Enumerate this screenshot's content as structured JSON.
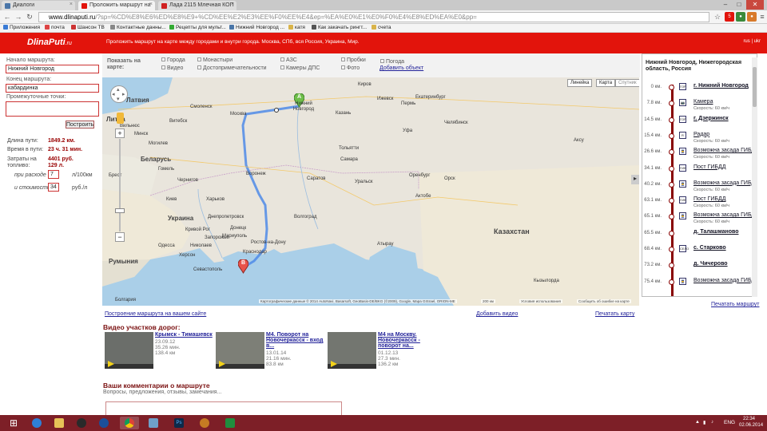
{
  "browser": {
    "tabs": [
      {
        "label": "Диалоги",
        "color": "#4a76a8"
      },
      {
        "label": "Проложить маршрут на",
        "color": "#e2140c",
        "active": true
      },
      {
        "label": "Лада 2115 Млечная КОП",
        "color": "#d02020"
      }
    ],
    "url_host": "www.dlinaputi.ru",
    "url_rest": "/?sp=%CD%E8%E6%ED%E8%E9+%CD%EE%E2%E3%EE%F0%EE%E4&ep=%EA%E0%E1%E0%F0%E4%E8%ED%EA%E0&pp=",
    "bookmarks": [
      {
        "label": "Приложения",
        "color": "#3a7bd5"
      },
      {
        "label": "почта",
        "color": "#d44"
      },
      {
        "label": "Шансон ТВ",
        "color": "#c33"
      },
      {
        "label": "Контактные данны...",
        "color": "#888"
      },
      {
        "label": "Рецепты для мульт...",
        "color": "#3a3"
      },
      {
        "label": "Нижний Новгород ...",
        "color": "#4a76a8"
      },
      {
        "label": "катя",
        "color": "#d9b44a"
      },
      {
        "label": "Как закачать рингт...",
        "color": "#555"
      },
      {
        "label": "счета",
        "color": "#d9b44a"
      }
    ]
  },
  "site": {
    "logo": "DlinaPuti",
    "logo_suffix": ".ru",
    "slogan": "Проложить маршрут на карте между городами и внутри города. Москва, СПб, вся Россия, Украина, Мир.",
    "header_right": "rus | ukr"
  },
  "form": {
    "start_label": "Начало маршрута:",
    "start_value": "Нижний Новгород",
    "end_label": "Конец маршрута:",
    "end_value": "кабардинка",
    "via_label": "Промежуточные точки:",
    "button": "Построить"
  },
  "stats": {
    "length_label": "Длина пути:",
    "length_value": "1849.2  км.",
    "time_label": "Время в пути:",
    "time_value": "23 ч. 31 мин.",
    "cost_label": "Затраты на топливо:",
    "cost_value": "4401   руб.",
    "fuel_value": "129     л.",
    "consumption_label": "при расходе",
    "consumption_value": "7",
    "consumption_unit": "л/100км",
    "price_label": "и стоимости",
    "price_value": "34",
    "price_unit": "руб./л"
  },
  "maptools": {
    "show_label": "Показать на карте:",
    "checks": [
      "Города",
      "Видео",
      "Монастыри",
      "Достопримечательности",
      "АЗС",
      "Камеры ДПС",
      "Пробки",
      "Фото",
      "Погода"
    ],
    "add_object": "Добавить объект"
  },
  "map": {
    "type_buttons": [
      "Линейка",
      "Карта",
      "Спутник"
    ],
    "labels": [
      "Латвия",
      "Литва",
      "Москва",
      "Вильнюс",
      "Минск",
      "Беларусь",
      "Украина",
      "Киев",
      "Румыния",
      "Болгария",
      "Нижний Новгород",
      "Казань",
      "Екатеринбург",
      "Пермь",
      "Уфа",
      "Челябинск",
      "Самара",
      "Тольятти",
      "Саратов",
      "Воронеж",
      "Волгоград",
      "Харьков",
      "Днепропетровск",
      "Ростов-на-Дону",
      "Краснодар",
      "Одесса",
      "Запорожье",
      "Донецк",
      "Кривой Рог",
      "Николаев",
      "Чернигов",
      "Гомель",
      "Могилев",
      "Витебск",
      "Брест",
      "Казахстан",
      "Оренбург",
      "Орск",
      "Аксу",
      "Уральск",
      "Атырау",
      "Актобе",
      "Кызылорда",
      "Мариуполь",
      "Херсон",
      "Севастополь",
      "Смоленск",
      "Ижевск",
      "Киров"
    ],
    "attribution": "Картографические данные © 2014 AutoNavi, Basarsoft, GeoBasis-DE/BKG (©2009), Google, Mapa GISrael, ORION-ME",
    "scale": "200 км",
    "terms": "Условия использования",
    "report": "Сообщить об ошибке на карте",
    "marker_a": "A",
    "marker_b": "B"
  },
  "route": {
    "header": "Нижний Новгород, Нижегородская область, Россия",
    "items": [
      {
        "km": "0 км.",
        "icon": "город",
        "name": "г. Нижний Новгород",
        "sub": "",
        "bold": true
      },
      {
        "km": "7.8 км.",
        "icon": "cam",
        "name": "Камера",
        "sub": "Скорость: 60 км/ч",
        "bold": false
      },
      {
        "km": "14.5 км.",
        "icon": "город",
        "name": "г. Дзержинск",
        "sub": "",
        "bold": true
      },
      {
        "km": "15.4 км.",
        "icon": "rad",
        "name": "Радар",
        "sub": "Скорость: 60 км/ч",
        "bold": false
      },
      {
        "km": "26.6 км.",
        "icon": "gibdd",
        "name": "Возможна засада ГИБД",
        "sub": "Скорость: 60 км/ч",
        "bold": false
      },
      {
        "km": "34.1 км.",
        "icon": "post",
        "name": "Пост ГИБДД",
        "sub": "",
        "bold": false
      },
      {
        "km": "40.2 км.",
        "icon": "gibdd",
        "name": "Возможна засада ГИБД",
        "sub": "Скорость: 60 км/ч",
        "bold": false
      },
      {
        "km": "63.1 км.",
        "icon": "post",
        "name": "Пост ГИБДД",
        "sub": "Скорость: 60 км/ч",
        "bold": false
      },
      {
        "km": "65.1 км.",
        "icon": "gibdd",
        "name": "Возможна засада ГИБД",
        "sub": "Скорость: 60 км/ч",
        "bold": false
      },
      {
        "km": "65.5 км.",
        "icon": "",
        "name": "д. Талашманово",
        "sub": "",
        "bold": true
      },
      {
        "km": "68.4 км.",
        "icon": "село",
        "name": "с. Старково",
        "sub": "",
        "bold": true
      },
      {
        "km": "73.2 км.",
        "icon": "",
        "name": "д. Чичерово",
        "sub": "",
        "bold": true
      },
      {
        "km": "75.4 км.",
        "icon": "gibdd",
        "name": "Возможна засада ГИБД",
        "sub": "",
        "bold": false
      }
    ],
    "print": "Печатать маршрут"
  },
  "links": {
    "embed": "Построение маршрута на вашем сайте",
    "add_video": "Добавить видео",
    "print_map": "Печатать карту"
  },
  "videos": {
    "title": "Видео участков дорог:",
    "items": [
      {
        "title": "Крымск - Тимашевск",
        "date": "23.09.12",
        "dur": "35.26 мин.",
        "dist": "138.4 км"
      },
      {
        "title": "М4. Поворот на Новочеркасск - вход в...",
        "date": "13.01.14",
        "dur": "21.16 мин.",
        "dist": "83.8 км"
      },
      {
        "title": "М4 на Москву. Новочеркасск - поворот на...",
        "date": "01.12.13",
        "dur": "27.3 мин.",
        "dist": "136.2 км"
      }
    ]
  },
  "comments": {
    "title": "Ваши комментарии о маршруте",
    "sub": "Вопросы, предложения, отзывы, замечания..."
  },
  "taskbar": {
    "lang": "ENG",
    "time": "22:34",
    "date": "02.06.2014"
  }
}
